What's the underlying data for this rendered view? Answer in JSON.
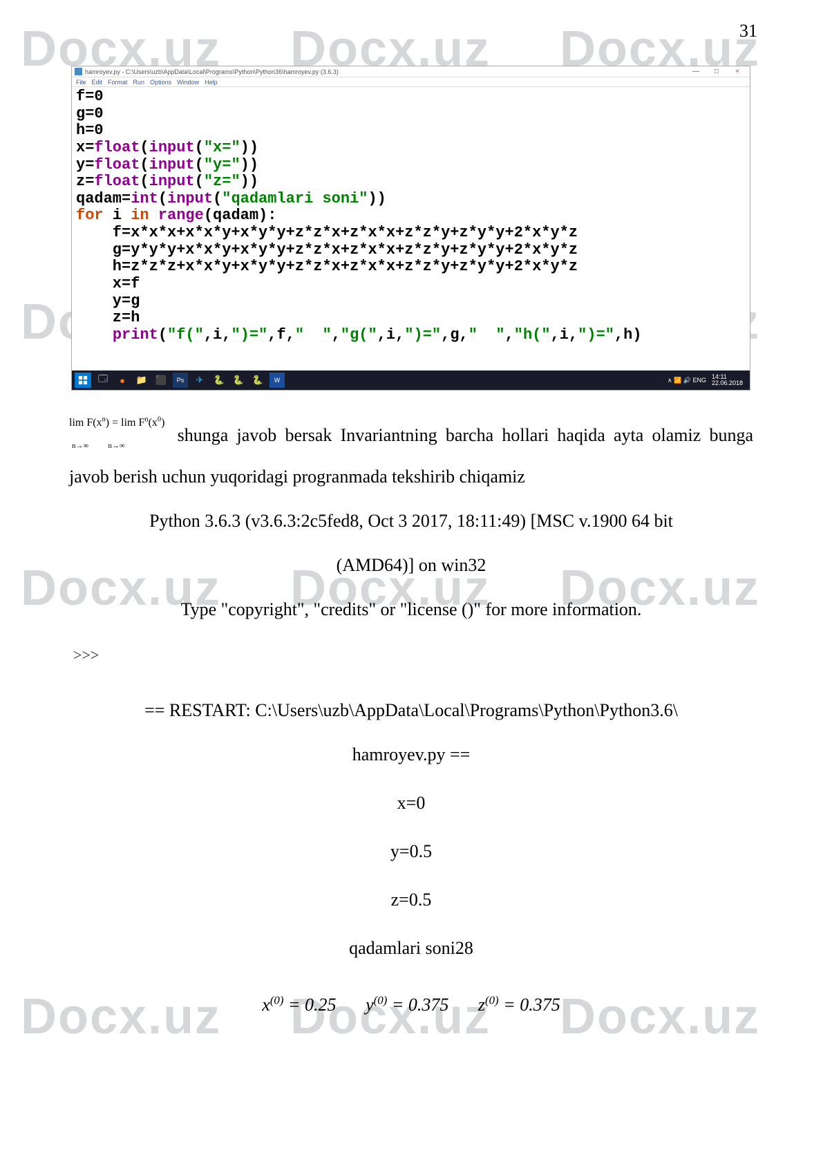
{
  "page_number": "31",
  "watermark": "Docx.uz",
  "ide": {
    "title": "hamroyev.py - C:\\Users\\uzb\\AppData\\Local\\Programs\\Python\\Python36\\hamroyev.py (3.6.3)",
    "menu": {
      "file": "File",
      "edit": "Edit",
      "format": "Format",
      "run": "Run",
      "options": "Options",
      "window": "Window",
      "help": "Help"
    },
    "win": {
      "min": "—",
      "max": "□",
      "close": "×"
    },
    "code": {
      "l1": "f=0",
      "l2": "g=0",
      "l3": "h=0",
      "l4a": "x=",
      "l4b": "float",
      "l4c": "(",
      "l4d": "input",
      "l4e": "(",
      "l4f": "\"x=\"",
      "l4g": "))",
      "l5a": "y=",
      "l5b": "float",
      "l5c": "(",
      "l5d": "input",
      "l5e": "(",
      "l5f": "\"y=\"",
      "l5g": "))",
      "l6a": "z=",
      "l6b": "float",
      "l6c": "(",
      "l6d": "input",
      "l6e": "(",
      "l6f": "\"z=\"",
      "l6g": "))",
      "l7a": "qadam=",
      "l7b": "int",
      "l7c": "(",
      "l7d": "input",
      "l7e": "(",
      "l7f": "\"qadamlari soni\"",
      "l7g": "))",
      "l8a": "for ",
      "l8b": "i ",
      "l8c": "in ",
      "l8d": "range",
      "l8e": "(qadam):",
      "l9": "    f=x*x*x+x*x*y+x*y*y+z*z*x+z*x*x+z*z*y+z*y*y+2*x*y*z",
      "l10": "    g=y*y*y+x*x*y+x*y*y+z*z*x+z*x*x+z*z*y+z*y*y+2*x*y*z",
      "l11": "    h=z*z*z+x*x*y+x*y*y+z*z*x+z*x*x+z*z*y+z*y*y+2*x*y*z",
      "l12": "    x=f",
      "l13": "    y=g",
      "l14": "    z=h",
      "l15a": "    ",
      "l15b": "print",
      "l15c": "(",
      "l15d": "\"f(\"",
      "l15e": ",i,",
      "l15f": "\")=\"",
      "l15g": ",f,",
      "l15h": "\"  \"",
      "l15i": ",",
      "l15j": "\"g(\"",
      "l15k": ",i,",
      "l15l": "\")=\"",
      "l15m": ",g,",
      "l15n": "\"  \"",
      "l15o": ",",
      "l15p": "\"h(\"",
      "l15q": ",i,",
      "l15r": "\")=\"",
      "l15s": ",h)"
    },
    "taskbar": {
      "sys": "∧  📶 🔊  ENG",
      "time": "14:11",
      "date": "22.06.2018"
    }
  },
  "body": {
    "lim1": "lim F(x",
    "lim1_sup": "n",
    "lim2": ") = lim F",
    "lim2_sup": "n",
    "lim3": "(x",
    "lim3_sup": "0",
    "lim4": ")",
    "lim_sub": "n→∞",
    "para1": " shunga javob bersak Invariantning barcha hollari haqida ayta olamiz bunga javob berish uchun yuqoridagi progranmada tekshirib chiqamiz",
    "python_line": "Python 3.6.3 (v3.6.3:2c5fed8, Oct  3 2017, 18:11:49) [MSC v.1900 64 bit",
    "amd_line": "(AMD64)] on win32",
    "type_line": "Type \"copyright\", \"credits\" or \"license ()\" for more information.",
    "prompt": ">>>",
    "restart": "== RESTART: C:\\Users\\uzb\\AppData\\Local\\Programs\\Python\\Python3.6\\",
    "restart2": "hamroyev.py ==",
    "x_eq": "x=0",
    "y_eq": "y=0.5",
    "z_eq": "z=0.5",
    "qadam": "qadamlari soni28",
    "eq": {
      "x_pre": "x",
      "x_sup": "(0)",
      "x_val": " = 0.25",
      "y_pre": "y",
      "y_sup": "(0)",
      "y_val": " = 0.375",
      "z_pre": "z",
      "z_sup": "(0)",
      "z_val": " = 0.375"
    }
  }
}
